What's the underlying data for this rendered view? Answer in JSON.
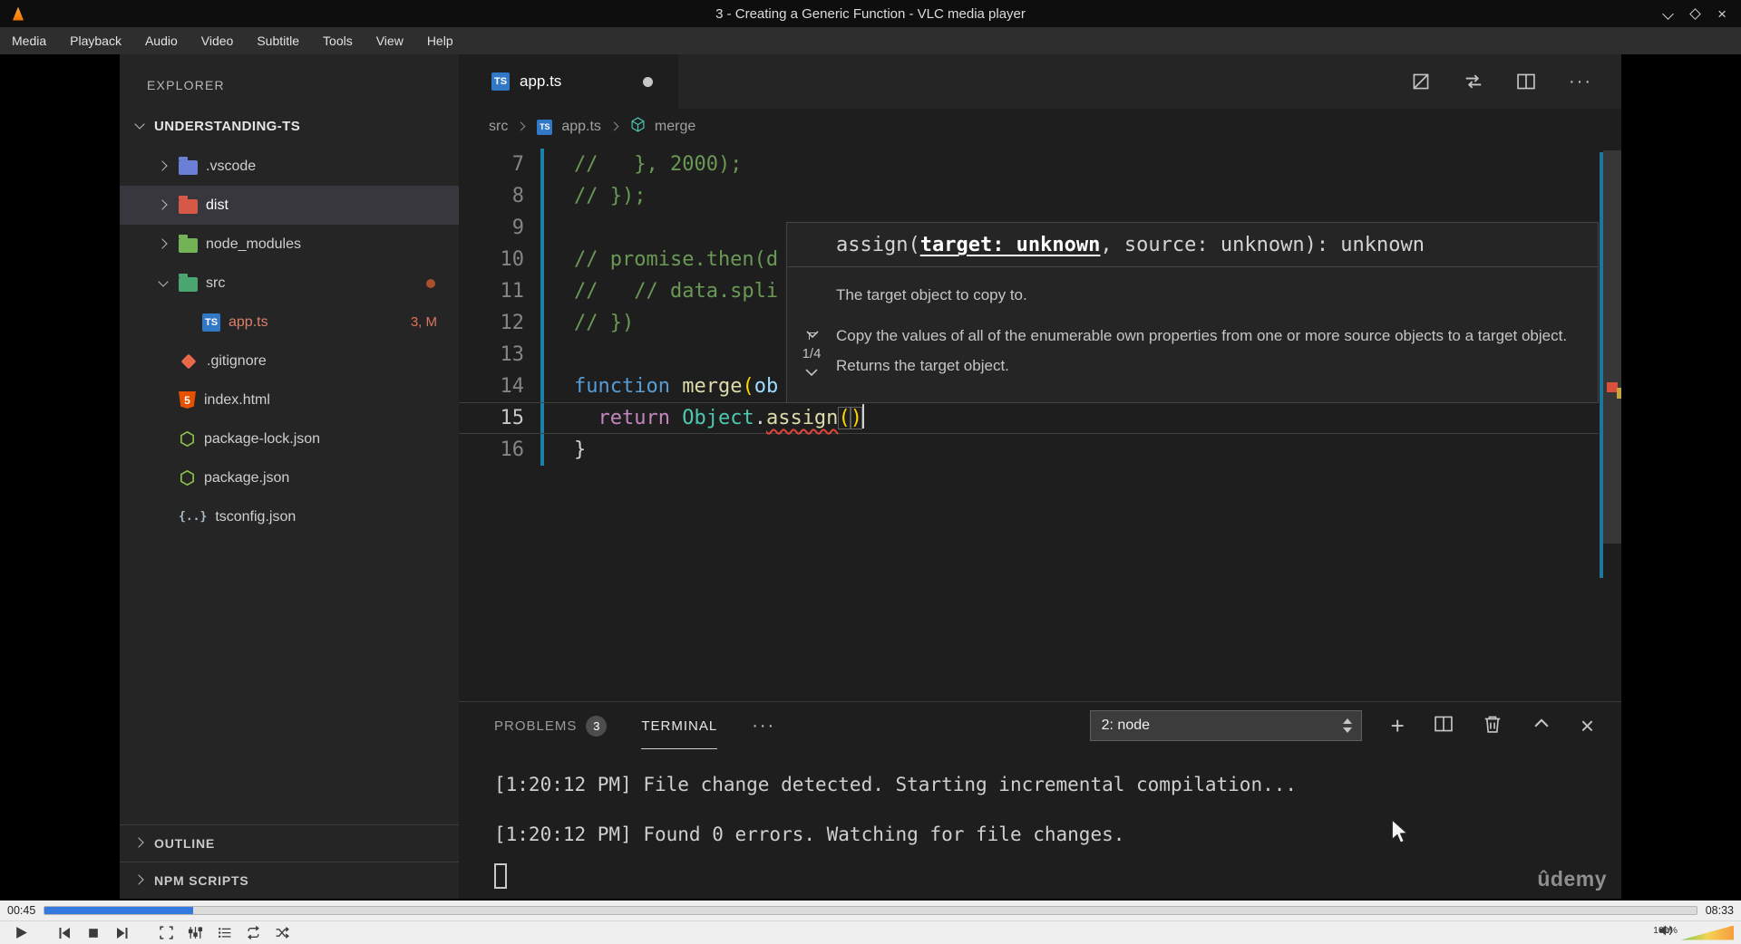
{
  "vlc": {
    "title": "3 - Creating a Generic Function - VLC media player",
    "menu": {
      "media": "Media",
      "playback": "Playback",
      "audio": "Audio",
      "video": "Video",
      "subtitle": "Subtitle",
      "tools": "Tools",
      "view": "View",
      "help": "Help"
    },
    "seek": {
      "elapsed": "00:45",
      "total": "08:33",
      "progress_pct": 9
    },
    "volume": {
      "label": "101%"
    }
  },
  "glyphs": {
    "plus": "+",
    "close": "×",
    "more": "···"
  },
  "icons": {
    "ts": "TS",
    "html5": "5",
    "braces": "{..}"
  },
  "explorer": {
    "header": "EXPLORER",
    "project": "UNDERSTANDING-TS",
    "items": {
      "vscode": ".vscode",
      "dist": "dist",
      "node_modules": "node_modules",
      "src": "src",
      "appts": "app.ts",
      "appts_badge": "3, M",
      "gitignore": ".gitignore",
      "indexhtml": "index.html",
      "package_lock": "package-lock.json",
      "package": "package.json",
      "tsconfig": "tsconfig.json"
    },
    "sections": {
      "outline": "OUTLINE",
      "npm": "NPM SCRIPTS"
    }
  },
  "editor": {
    "tab": "app.ts",
    "breadcrumbs": {
      "root": "src",
      "file": "app.ts",
      "symbol": "merge"
    },
    "lines": {
      "l7": {
        "num": "7",
        "text": "//   }, 2000);"
      },
      "l8": {
        "num": "8",
        "text": "// });"
      },
      "l9": {
        "num": "9",
        "text": ""
      },
      "l10": {
        "num": "10",
        "text": "// promise.then(d"
      },
      "l11": {
        "num": "11",
        "text": "//   // data.spli"
      },
      "l12": {
        "num": "12",
        "text": "// })"
      },
      "l13": {
        "num": "13",
        "text": ""
      },
      "l14": {
        "num": "14",
        "kw": "function ",
        "fn": "merge",
        "br": "(",
        "param": "ob"
      },
      "l15": {
        "num": "15",
        "indent": "  ",
        "kw": "return ",
        "cls": "Object",
        "dot": ".",
        "fn": "assign",
        "p1": "(",
        "p2": ")"
      },
      "l16": {
        "num": "16",
        "text": "}"
      }
    },
    "hover": {
      "sig_pre": "assign(",
      "sig_param": "target: unknown",
      "sig_post": ", source: unknown): unknown",
      "param_doc": "The target object to copy to.",
      "doc": "Copy the values of all of the enumerable own properties from one or more source objects to a target object. Returns the target object.",
      "pager": "1/4"
    }
  },
  "panel": {
    "problems_label": "PROBLEMS",
    "problems_badge": "3",
    "terminal_label": "TERMINAL",
    "dropdown": "2: node",
    "terminal": {
      "line1": "[1:20:12 PM] File change detected. Starting incremental compilation...",
      "line2": "[1:20:12 PM] Found 0 errors. Watching for file changes."
    },
    "watermark": "ûdemy"
  }
}
